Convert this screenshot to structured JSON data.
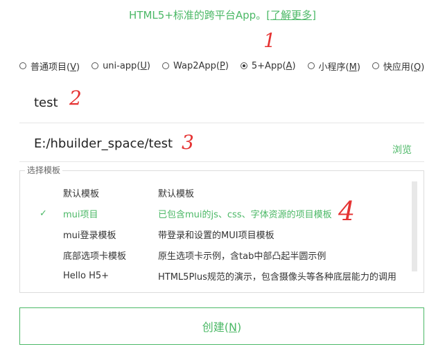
{
  "header": {
    "text": "HTML5+标准的跨平台App。",
    "link": "[了解更多]"
  },
  "annotations": [
    "1",
    "2",
    "3",
    "4"
  ],
  "project_types": [
    {
      "label": "普通项目(",
      "key": "V",
      "suffix": ")",
      "checked": false
    },
    {
      "label": "uni-app(",
      "key": "U",
      "suffix": ")",
      "checked": false
    },
    {
      "label": "Wap2App(",
      "key": "P",
      "suffix": ")",
      "checked": false
    },
    {
      "label": "5+App(",
      "key": "A",
      "suffix": ")",
      "checked": true
    },
    {
      "label": "小程序(",
      "key": "M",
      "suffix": ")",
      "checked": false
    },
    {
      "label": "快应用(",
      "key": "Q",
      "suffix": ")",
      "checked": false
    }
  ],
  "project_name": "test",
  "project_path": "E:/hbuilder_space/test",
  "browse_label": "浏览",
  "template_section": "选择模板",
  "templates": [
    {
      "name": "默认模板",
      "desc": "默认模板",
      "selected": false
    },
    {
      "name": "mui项目",
      "desc": "已包含mui的js、css、字体资源的项目模板",
      "selected": true
    },
    {
      "name": "mui登录模板",
      "desc": "带登录和设置的MUI项目模板",
      "selected": false
    },
    {
      "name": "底部选项卡模板",
      "desc": "原生选项卡示例，含tab中部凸起半圆示例",
      "selected": false
    },
    {
      "name": "Hello H5+",
      "desc": "HTML5Plus规范的演示，包含摄像头等各种底层能力的调用",
      "selected": false
    }
  ],
  "create_button": {
    "label": "创建(",
    "key": "N",
    "suffix": ")"
  },
  "check_mark": "✓",
  "colors": {
    "accent": "#4bb866",
    "annotation": "#e53333"
  }
}
